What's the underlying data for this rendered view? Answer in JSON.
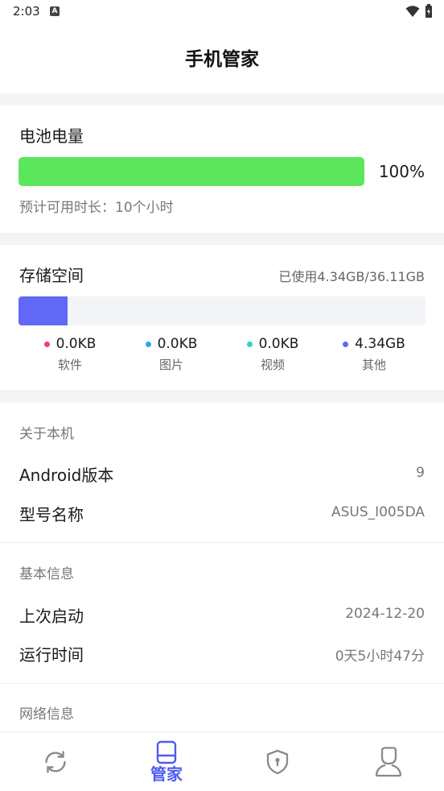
{
  "status": {
    "time": "2:03",
    "notif_letter": "A"
  },
  "header": {
    "title": "手机管家"
  },
  "battery": {
    "title": "电池电量",
    "percent_label": "100%",
    "level_fraction": 1.0,
    "estimate": "预计可用时长：10个小时",
    "bar_color": "#5ce65c"
  },
  "storage": {
    "title": "存储空间",
    "used_summary": "已使用4.34GB/36.11GB",
    "used_fraction": 0.12,
    "bar_color": "#6068f5",
    "categories": [
      {
        "value": "0.0KB",
        "label": "软件",
        "color": "#f0406e"
      },
      {
        "value": "0.0KB",
        "label": "图片",
        "color": "#28aaf0"
      },
      {
        "value": "0.0KB",
        "label": "视频",
        "color": "#2ad6c8"
      },
      {
        "value": "4.34GB",
        "label": "其他",
        "color": "#6068f5"
      }
    ]
  },
  "about": {
    "title": "关于本机",
    "rows": [
      {
        "label": "Android版本",
        "value": "9"
      },
      {
        "label": "型号名称",
        "value": "ASUS_I005DA"
      }
    ]
  },
  "basic": {
    "title": "基本信息",
    "rows": [
      {
        "label": "上次启动",
        "value": "2024-12-20"
      },
      {
        "label": "运行时间",
        "value": "0天5小时47分"
      }
    ]
  },
  "network": {
    "title": "网络信息"
  },
  "nav": {
    "active_label": "管家",
    "items": [
      "refresh-icon",
      "device-icon",
      "shield-icon",
      "user-icon"
    ],
    "active_color": "#4d5bf0"
  }
}
